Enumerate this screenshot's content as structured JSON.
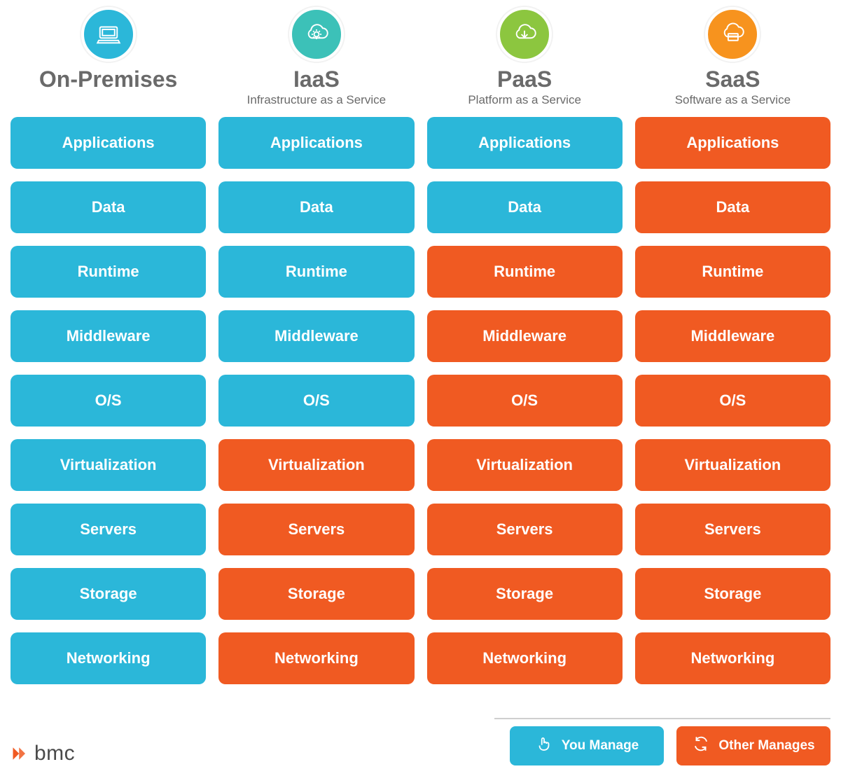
{
  "colors": {
    "you_manage": "#2bb7d9",
    "other_manages": "#f05a22",
    "header_text": "#6a6a6a",
    "badge_onprem": "#2bb7d9",
    "badge_iaas": "#3cc1b8",
    "badge_paas": "#8cc63f",
    "badge_saas": "#f7931e"
  },
  "layers": [
    "Applications",
    "Data",
    "Runtime",
    "Middleware",
    "O/S",
    "Virtualization",
    "Servers",
    "Storage",
    "Networking"
  ],
  "columns": [
    {
      "key": "onprem",
      "title": "On-Premises",
      "subtitle": "",
      "icon": "laptop-icon",
      "badge_color": "#2bb7d9",
      "managed": [
        "you",
        "you",
        "you",
        "you",
        "you",
        "you",
        "you",
        "you",
        "you"
      ]
    },
    {
      "key": "iaas",
      "title": "IaaS",
      "subtitle": "Infrastructure as a Service",
      "icon": "cloud-gear-icon",
      "badge_color": "#3cc1b8",
      "managed": [
        "you",
        "you",
        "you",
        "you",
        "you",
        "other",
        "other",
        "other",
        "other"
      ]
    },
    {
      "key": "paas",
      "title": "PaaS",
      "subtitle": "Platform as a Service",
      "icon": "cloud-download-icon",
      "badge_color": "#8cc63f",
      "managed": [
        "you",
        "you",
        "other",
        "other",
        "other",
        "other",
        "other",
        "other",
        "other"
      ]
    },
    {
      "key": "saas",
      "title": "SaaS",
      "subtitle": "Software as a Service",
      "icon": "cloud-window-icon",
      "badge_color": "#f7931e",
      "managed": [
        "other",
        "other",
        "other",
        "other",
        "other",
        "other",
        "other",
        "other",
        "other"
      ]
    }
  ],
  "legend": {
    "you_label": "You Manage",
    "other_label": "Other Manages"
  },
  "logo_text": "bmc"
}
